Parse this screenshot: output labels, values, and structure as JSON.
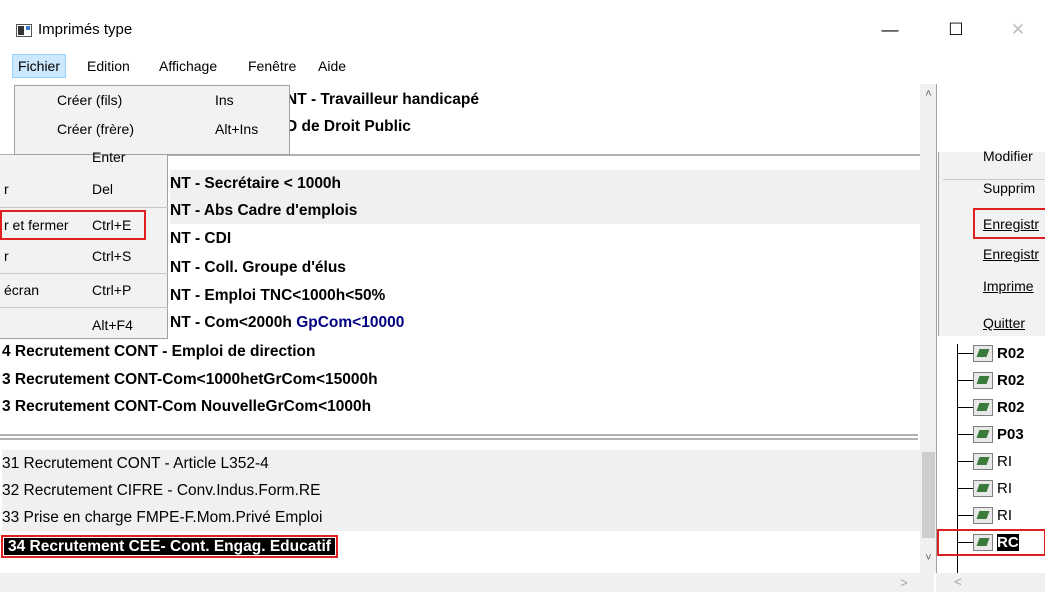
{
  "window": {
    "title": "Imprimés type",
    "caption_min": "—",
    "caption_max": "☐",
    "caption_close": "✕"
  },
  "menubar": {
    "fichier": "Fichier",
    "edition": "Edition",
    "affichage": "Affichage",
    "fenetre": "Fenêtre",
    "aide": "Aide"
  },
  "dropdown": {
    "items": [
      {
        "label": "Créer (fils)",
        "shortcut": "Ins"
      },
      {
        "label": "Créer (frère)",
        "shortcut": "Alt+Ins"
      }
    ],
    "fragment": [
      {
        "label": "",
        "shortcut": "Enter"
      },
      {
        "label": "r",
        "shortcut": "Del"
      },
      {
        "label": "r et fermer",
        "shortcut": "Ctrl+E"
      },
      {
        "label": "r",
        "shortcut": "Ctrl+S"
      },
      {
        "label": "écran",
        "shortcut": "Ctrl+P"
      },
      {
        "label": "",
        "shortcut": "Alt+F4"
      }
    ]
  },
  "list": {
    "rows": [
      {
        "text": "NT - Travailleur handicapé"
      },
      {
        "text": "D de Droit Public"
      },
      {
        "text": "NT - Secrétaire < 1000h"
      },
      {
        "text": "NT - Abs Cadre d'emplois"
      },
      {
        "text": "NT - CDI"
      },
      {
        "text": "NT - Coll. Groupe d'élus"
      },
      {
        "text": "NT - Emploi TNC<1000h<50%"
      },
      {
        "text": "NT - Com<2000h ",
        "text_blue": "GpCom<10000"
      },
      {
        "text": "4 Recrutement CONT - Emploi de direction"
      },
      {
        "text": "3 Recrutement CONT-Com<1000hetGrCom<15000h"
      },
      {
        "text": "3 Recrutement CONT-Com NouvelleGrCom<1000h"
      },
      {
        "text": "31 Recrutement CONT - Article L352-4"
      },
      {
        "text": "32 Recrutement CIFRE - Conv.Indus.Form.RE"
      },
      {
        "text": "33 Prise en charge FMPE-F.Mom.Privé Emploi"
      },
      {
        "text": "34 Recrutement CEE- Cont. Engag. Educatif"
      }
    ]
  },
  "context_menu": {
    "items": [
      "Modifier",
      "Supprim",
      "Enregistr",
      "Enregistr",
      "Imprime",
      "Quitter"
    ]
  },
  "tree": {
    "nodes": [
      "R02",
      "R02",
      "R02",
      "P03",
      "RI",
      "RI",
      "RI",
      "RC"
    ]
  },
  "scroll": {
    "up": "˄",
    "down": "˅",
    "right": ">",
    "left": "<"
  }
}
